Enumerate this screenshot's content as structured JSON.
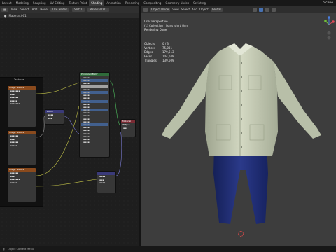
{
  "topbar": {
    "tabs": [
      "Layout",
      "Modeling",
      "Sculpting",
      "UV Editing",
      "Texture Paint",
      "Shading",
      "Animation",
      "Rendering",
      "Compositing",
      "Geometry Nodes",
      "Scripting"
    ],
    "active_tab": "Shading",
    "scene": "Scene"
  },
  "node_editor": {
    "header": {
      "object_label": "Object",
      "mode": "Slot 1",
      "material": "Material.001",
      "use_nodes": "Use Nodes",
      "view": "View",
      "select": "Select",
      "add": "Add",
      "node": "Node"
    },
    "subheader": {
      "material": "Material.001"
    },
    "frame_label": "Textures",
    "bsdf_title": "Principled BSDF",
    "output_title": "Material Output",
    "tex_node_title": "Image Texture",
    "mix_node_title": "Bump"
  },
  "viewport": {
    "header": {
      "mode": "Object Mode",
      "view": "View",
      "select": "Select",
      "add": "Add",
      "object": "Object",
      "transform": "Global"
    },
    "overlay": {
      "perspective": "User Perspective",
      "collection": "(1) Collection | jeans_shirt_thin",
      "render": "Rendering Done"
    },
    "stats": [
      {
        "k": "Objects",
        "v": "0 / 3"
      },
      {
        "k": "Vertices",
        "v": "75,031"
      },
      {
        "k": "Edges",
        "v": "179,613"
      },
      {
        "k": "Faces",
        "v": "104,049"
      },
      {
        "k": "Triangles",
        "v": "139,609"
      }
    ]
  },
  "statusbar": {
    "text": "Object Context Menu"
  },
  "colors": {
    "shirt": "#c9cfb8",
    "jeans": "#1e2c6e",
    "accent": "#4772b3"
  }
}
